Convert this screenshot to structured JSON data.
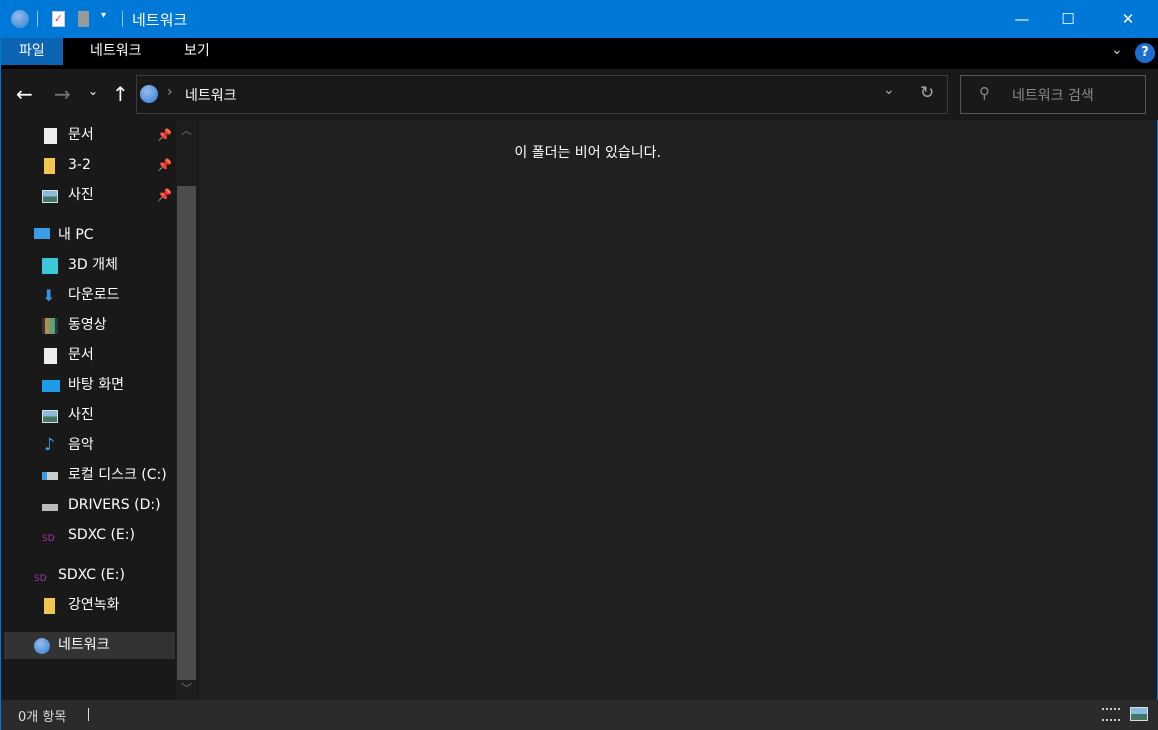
{
  "title": "네트워크",
  "ribbon": {
    "tabs": [
      "파일",
      "네트워크",
      "보기"
    ]
  },
  "nav": {
    "path": "네트워크",
    "search_placeholder": "네트워크 검색"
  },
  "sidebar": {
    "quick": [
      {
        "label": "문서",
        "icon": "document-icon"
      },
      {
        "label": "3-2",
        "icon": "folder-icon"
      },
      {
        "label": "사진",
        "icon": "pictures-icon"
      }
    ],
    "pc": {
      "label": "내 PC",
      "items": [
        {
          "label": "3D 개체",
          "icon": "3d-objects-icon"
        },
        {
          "label": "다운로드",
          "icon": "download-icon"
        },
        {
          "label": "동영상",
          "icon": "videos-icon"
        },
        {
          "label": "문서",
          "icon": "document-icon"
        },
        {
          "label": "바탕 화면",
          "icon": "desktop-icon"
        },
        {
          "label": "사진",
          "icon": "pictures-icon"
        },
        {
          "label": "음악",
          "icon": "music-icon"
        },
        {
          "label": "로컬 디스크 (C:)",
          "icon": "local-disk-icon"
        },
        {
          "label": "DRIVERS (D:)",
          "icon": "drive-icon"
        },
        {
          "label": "SDXC (E:)",
          "icon": "sd-card-icon"
        }
      ]
    },
    "sd": {
      "label": "SDXC (E:)",
      "items": [
        {
          "label": "강연녹화",
          "icon": "folder-icon"
        }
      ]
    },
    "network": {
      "label": "네트워크"
    }
  },
  "content": {
    "empty_message": "이 폴더는 비어 있습니다."
  },
  "status": {
    "count": "0개 항목"
  }
}
